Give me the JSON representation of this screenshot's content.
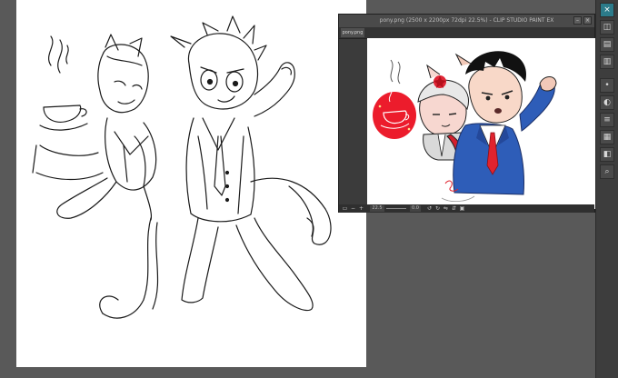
{
  "sub_window": {
    "title": "pony.png (2500 x 2200px 72dpi 22.5%) - CLIP STUDIO PAINT EX",
    "tab_label": "pony.png",
    "zoom_value": "22.5",
    "angle_value": "0.0"
  },
  "right_toolbar": {
    "icons": [
      "close-icon",
      "navigator-icon",
      "layer-icon",
      "property-icon",
      "brush-size-icon",
      "color-wheel-icon",
      "history-icon",
      "material-icon",
      "sub-view-icon",
      "search-icon"
    ]
  },
  "colors": {
    "workspace": "#595959",
    "accent": "#2c7b8a",
    "red_accent": "#e0232e",
    "suit_blue": "#2e5db8"
  }
}
